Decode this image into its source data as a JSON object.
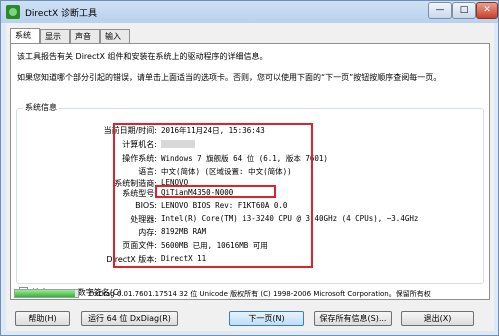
{
  "window": {
    "title": "DirectX 诊断工具",
    "min": "—",
    "max": "□",
    "close": "✕"
  },
  "tabs": [
    "系统",
    "显示",
    "声音",
    "输入"
  ],
  "intro": {
    "line1": "该工具报告有关 DirectX 组件和安装在系统上的驱动程序的详细信息。",
    "line2": "如果您知道哪个部分引起的错误，请单击上面适当的选项卡。否则，您可以使用下面的“下一页”按钮按顺序查阅每一页。"
  },
  "system_info": {
    "title": "系统信息",
    "rows": [
      {
        "label": "当前日期/时间:",
        "value": "2016年11月24日, 15:36:43"
      },
      {
        "label": "计算机名:",
        "value": ""
      },
      {
        "label": "操作系统:",
        "value": "Windows 7 旗舰版 64 位 (6.1, 版本 7601)"
      },
      {
        "label": "语言:",
        "value": "中文(简体) (区域设置: 中文(简体))"
      },
      {
        "label": "系统制造商:",
        "value": "LENOVO"
      },
      {
        "label": "系统型号:",
        "value": "QiTianM4350-N000"
      },
      {
        "label": "BIOS:",
        "value": "LENOVO BIOS Rev: F1KT60A 0.0"
      },
      {
        "label": "处理器:",
        "value": "Intel(R) Core(TM) i3-3240 CPU @ 3.40GHz (4 CPUs), ~3.4GHz"
      },
      {
        "label": "内存:",
        "value": "8192MB RAM"
      },
      {
        "label": "页面文件:",
        "value": "5600MB 已用, 10616MB 可用"
      },
      {
        "label": "DirectX 版本:",
        "value": "DirectX 11"
      }
    ]
  },
  "checkbox": {
    "label": "检查 WHQL 数字签名(C)",
    "checked": true,
    "mark": "✓"
  },
  "progress": {
    "fraction": 0.95
  },
  "footer": {
    "text": "DxDiag 6.01.7601.17514 32 位 Unicode 版权所有 (C) 1998-2006 Microsoft Corporation。保留所有权"
  },
  "buttons": {
    "help": "帮助(H)",
    "run64": "运行 64 位 DxDiag(R)",
    "next": "下一页(N)",
    "save": "保存所有信息(S)...",
    "exit": "退出(X)"
  },
  "colors": {
    "highlight": "#d8262c",
    "title_bg": "#cfe0f4"
  }
}
